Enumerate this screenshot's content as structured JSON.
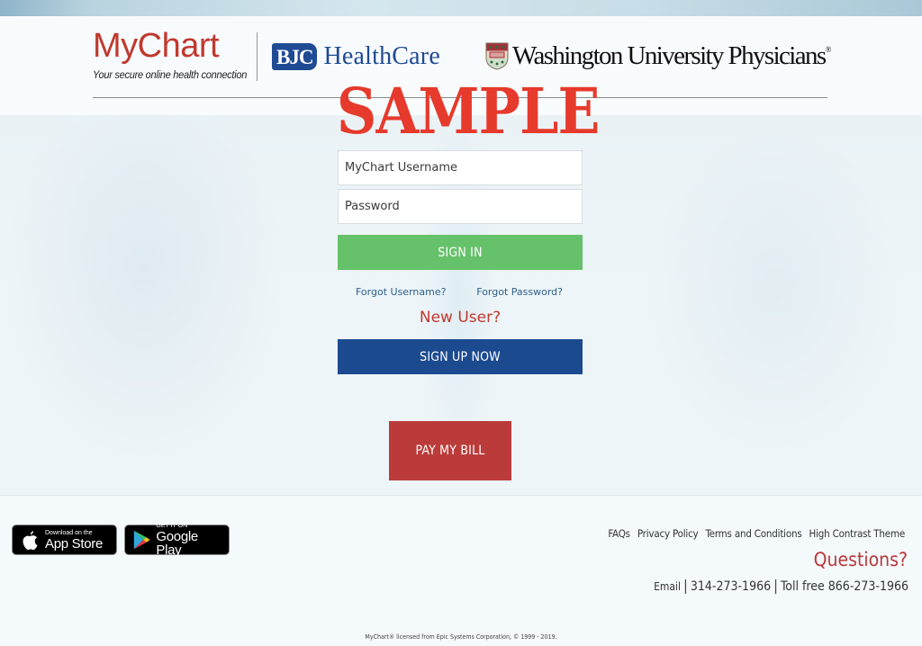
{
  "header": {
    "mychart_title": "MyChart",
    "mychart_tagline": "Your secure online health connection",
    "bjc_badge": "BJC",
    "bjc_name": "HealthCare",
    "wu_name": "Washington University Physicians",
    "wu_registered": "®"
  },
  "watermark": "SAMPLE",
  "login": {
    "username_placeholder": "MyChart Username",
    "username_value": "",
    "password_placeholder": "Password",
    "password_value": "",
    "signin_label": "SIGN IN",
    "forgot_username": "Forgot Username?",
    "forgot_password": "Forgot Password?",
    "new_user": "New User?",
    "signup_label": "SIGN UP NOW"
  },
  "pay_bill_label": "PAY MY BILL",
  "footer": {
    "app_store": {
      "small": "Download on the",
      "big": "App Store",
      "icon": "apple-icon"
    },
    "google_play": {
      "small": "GET IT ON",
      "big": "Google Play",
      "icon": "google-play-icon"
    },
    "links": [
      "FAQs",
      "Privacy Policy",
      "Terms and Conditions",
      "High Contrast Theme"
    ],
    "questions": "Questions?",
    "email_label": "Email",
    "separator": "|",
    "phone": "314-273-1966",
    "toll_free": "Toll free 866-273-1966",
    "copyright": "MyChart® licensed from Epic Systems Corporation, © 1999 - 2019."
  },
  "colors": {
    "brand_red": "#c0392f",
    "signin_green": "#66c16b",
    "signup_blue": "#1c4a8f",
    "paybill_red": "#ba3b3a",
    "bjc_blue": "#1f4a94",
    "watermark_red": "#e63a2c",
    "link_blue": "#2d5f8c"
  }
}
